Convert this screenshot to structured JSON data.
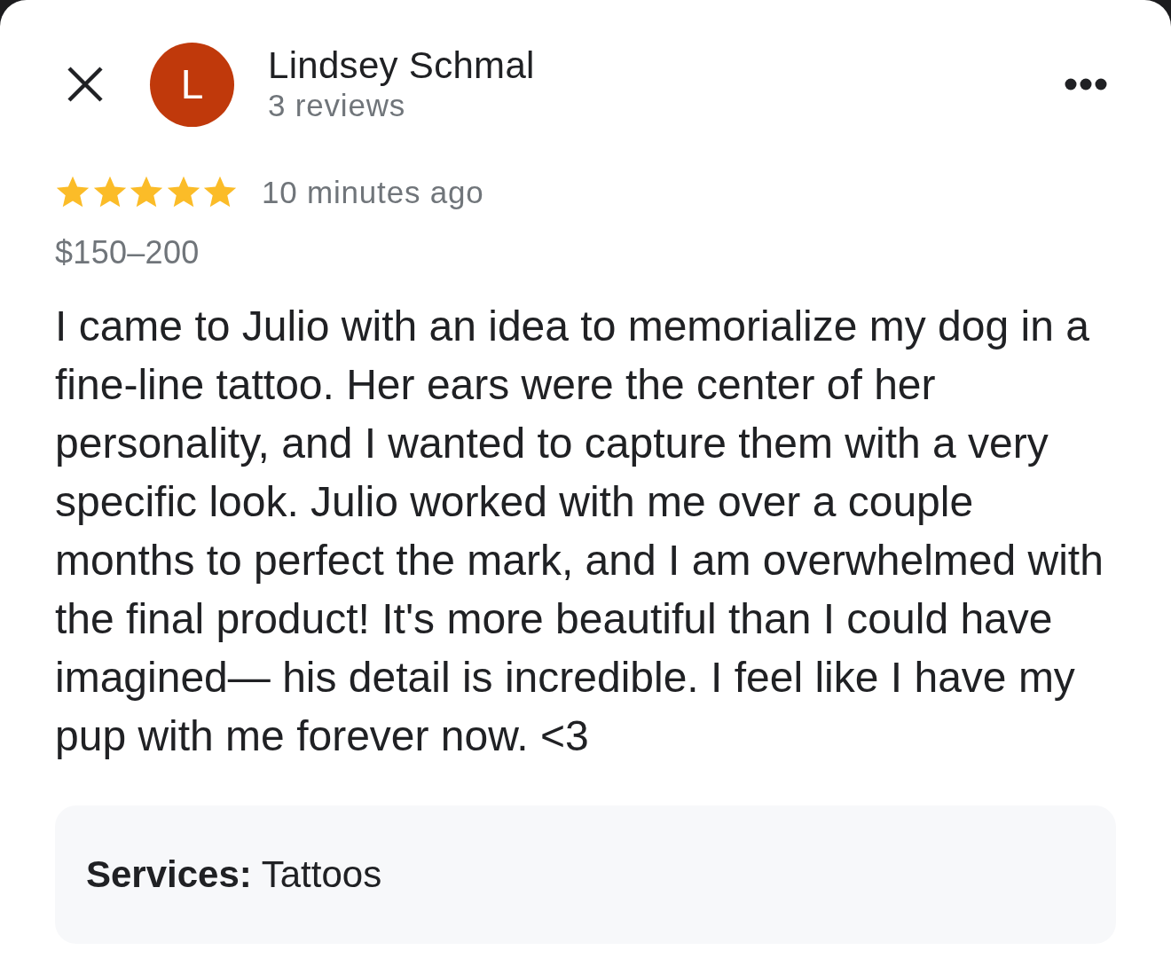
{
  "reviewer": {
    "initial": "L",
    "name": "Lindsey Schmal",
    "review_count": "3 reviews"
  },
  "review": {
    "stars": 5,
    "time": "10 minutes ago",
    "price": "$150–200",
    "text": "I came to Julio with an idea to memorialize my dog in a fine-line tattoo. Her ears were the center of her personality, and I wanted to capture them with a very specific look. Julio worked with me over a couple months to perfect the mark, and I am overwhelmed with the final product! It's more beautiful than I could have imagined— his detail is incredible. I feel like I have my pup with me forever now. <3",
    "services": "**Services:** Tattoos"
  }
}
